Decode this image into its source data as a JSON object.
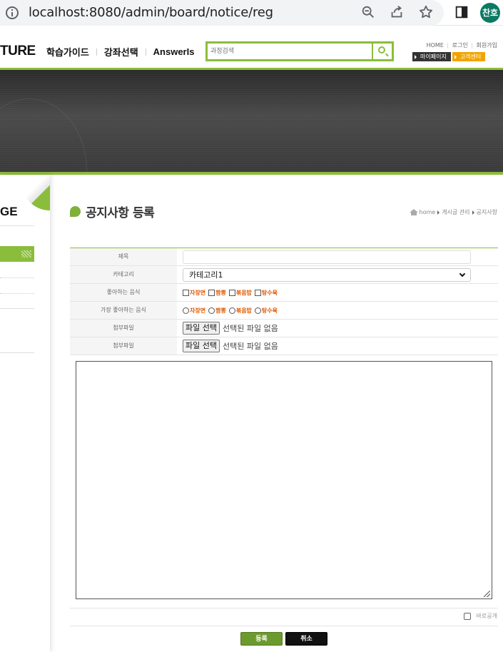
{
  "browser": {
    "url": "localhost:8080/admin/board/notice/reg",
    "profile_initials": "찬호"
  },
  "header": {
    "logo": "TURE",
    "nav": [
      "학습가이드",
      "강좌선택",
      "AnswerIs"
    ],
    "search_placeholder": "과정검색",
    "util_links": [
      "HOME",
      "로그인",
      "회원가입"
    ],
    "mypage_label": "마이페이지",
    "support_label": "고객센터",
    "accent_color": "#8bbd3c"
  },
  "sidebar": {
    "title": "GE"
  },
  "main": {
    "title": "공지사항 등록",
    "breadcrumb": [
      "home",
      "게시글 관리",
      "공지사항"
    ],
    "form": {
      "title_label": "제목",
      "title_value": "",
      "category_label": "카테고리",
      "category_selected": "카테고리1",
      "food_label": "좋아하는 음식",
      "food_options": [
        "자장면",
        "짬뽕",
        "볶음밥",
        "탕수육"
      ],
      "favorite_label": "가장 좋아하는 음식",
      "favorite_options": [
        "자장면",
        "짬뽕",
        "볶음밥",
        "탕수육"
      ],
      "file_label_1": "첨부파일",
      "file_label_2": "첨부파일",
      "file_button": "파일 선택",
      "file_status": "선택된 파일 없음",
      "content_value": ""
    },
    "publish_label": "바로공개",
    "submit_label": "등록",
    "cancel_label": "취소"
  }
}
